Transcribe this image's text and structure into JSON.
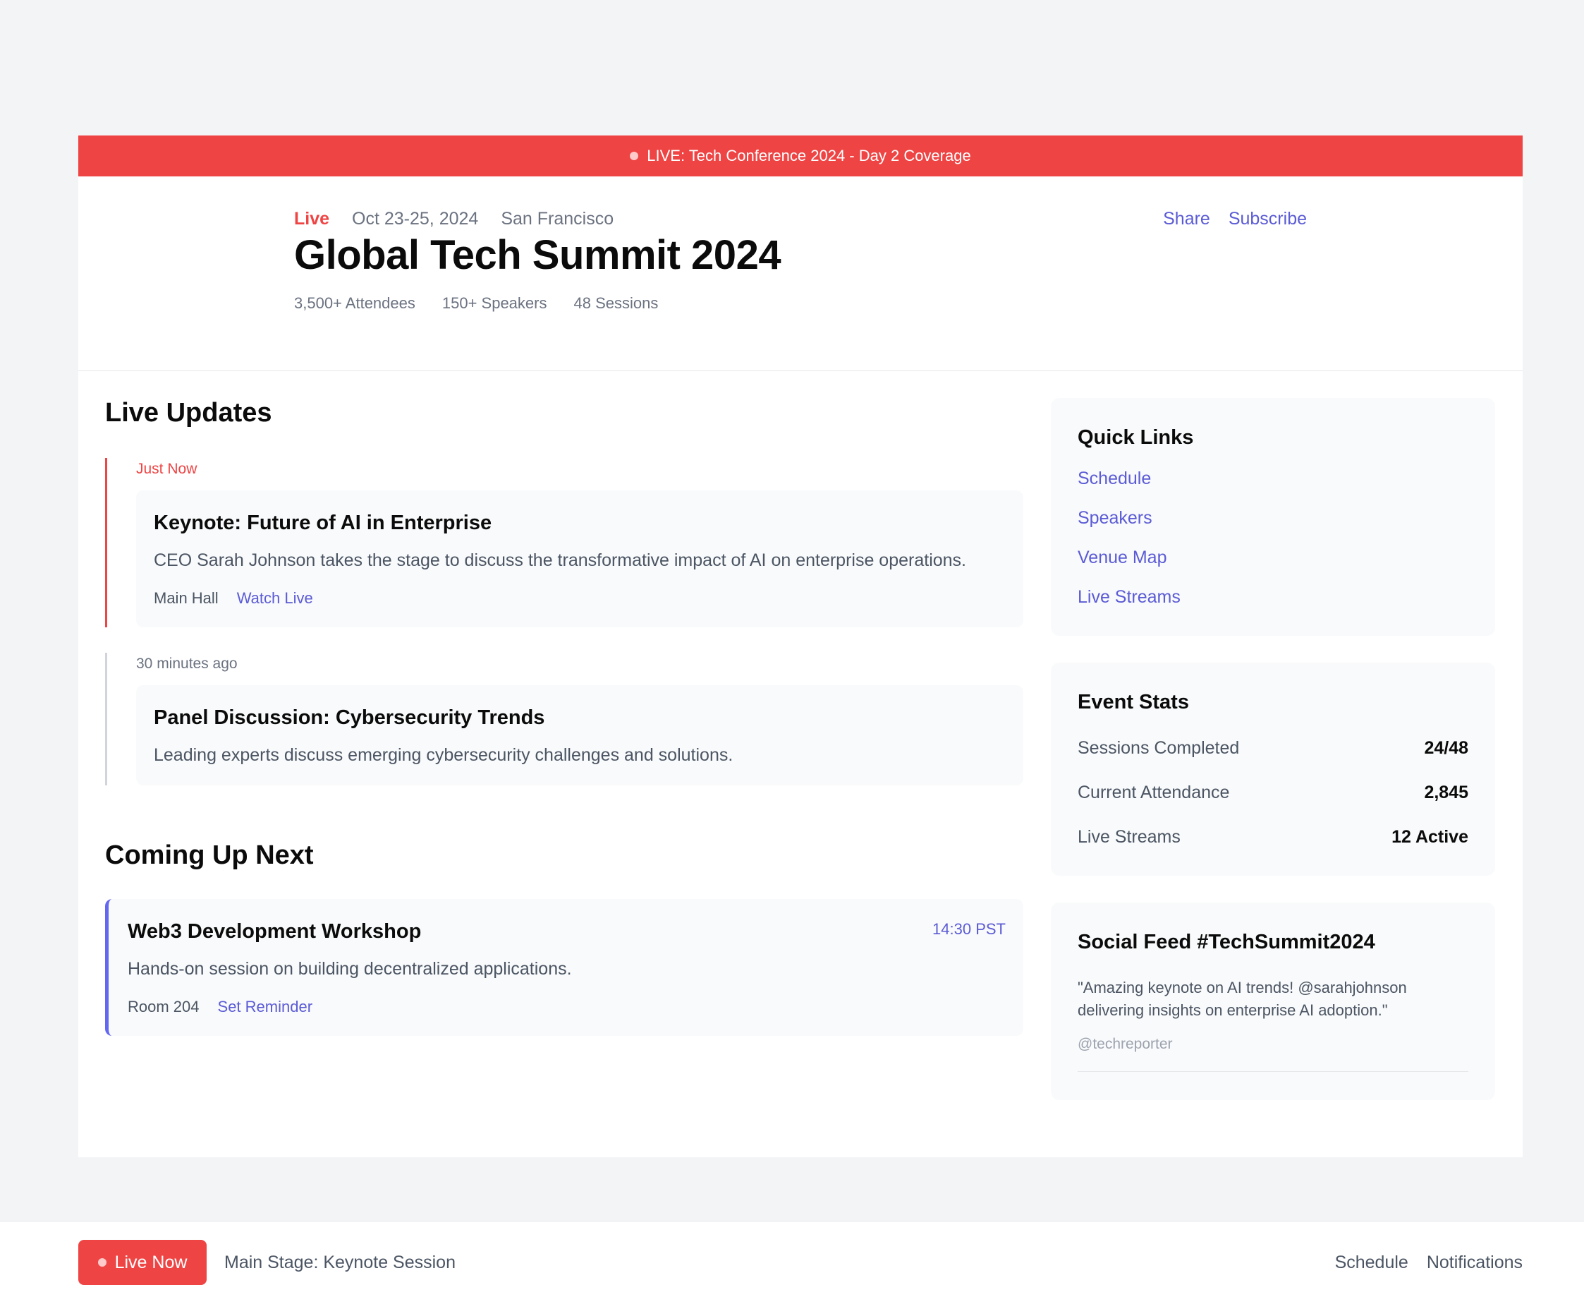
{
  "banner": {
    "text": "LIVE: Tech Conference 2024 - Day 2 Coverage"
  },
  "hero": {
    "status": "Live",
    "date": "Oct 23-25, 2024",
    "location": "San Francisco",
    "actions": {
      "share": "Share",
      "subscribe": "Subscribe"
    },
    "title": "Global Tech Summit 2024",
    "stats": [
      "3,500+ Attendees",
      "150+ Speakers",
      "48 Sessions"
    ]
  },
  "live_updates": {
    "title": "Live Updates",
    "items": [
      {
        "time": "Just Now",
        "title": "Keynote: Future of AI in Enterprise",
        "description": "CEO Sarah Johnson takes the stage to discuss the transformative impact of AI on enterprise operations.",
        "location": "Main Hall",
        "action": "Watch Live"
      },
      {
        "time": "30 minutes ago",
        "title": "Panel Discussion: Cybersecurity Trends",
        "description": "Leading experts discuss emerging cybersecurity challenges and solutions."
      }
    ]
  },
  "coming_up": {
    "title": "Coming Up Next",
    "item": {
      "title": "Web3 Development Workshop",
      "time": "14:30 PST",
      "description": "Hands-on session on building decentralized applications.",
      "location": "Room 204",
      "action": "Set Reminder"
    }
  },
  "quick_links": {
    "title": "Quick Links",
    "items": [
      "Schedule",
      "Speakers",
      "Venue Map",
      "Live Streams"
    ]
  },
  "event_stats": {
    "title": "Event Stats",
    "rows": [
      {
        "label": "Sessions Completed",
        "value": "24/48"
      },
      {
        "label": "Current Attendance",
        "value": "2,845"
      },
      {
        "label": "Live Streams",
        "value": "12 Active"
      }
    ]
  },
  "social": {
    "title": "Social Feed #TechSummit2024",
    "quote": "\"Amazing keynote on AI trends! @sarahjohnson delivering insights on enterprise AI adoption.\"",
    "handle": "@techreporter"
  },
  "bottom_bar": {
    "live_button": "Live Now",
    "now_playing": "Main Stage: Keynote Session",
    "links": [
      "Schedule",
      "Notifications"
    ]
  },
  "colors": {
    "live_red": "#ef4444",
    "accent": "#5b5bd6",
    "next_border": "#6366f1"
  }
}
